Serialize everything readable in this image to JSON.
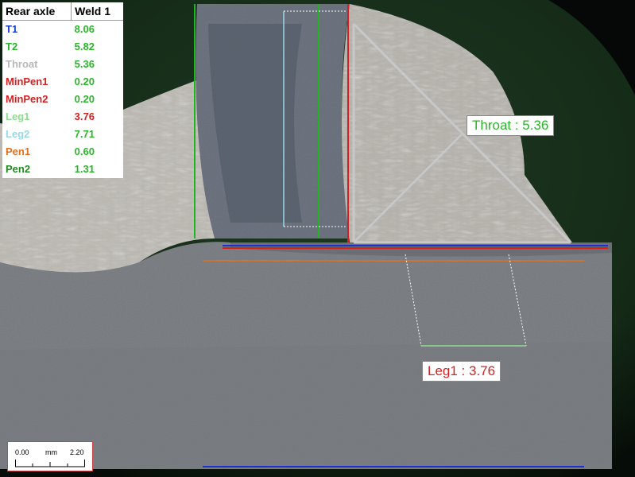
{
  "table": {
    "header_left": "Rear axle",
    "header_right": "Weld 1",
    "rows": [
      {
        "label": "T1",
        "value": "8.06",
        "label_color": "#1a3fd0",
        "value_color": "#2ab52a"
      },
      {
        "label": "T2",
        "value": "5.82",
        "label_color": "#2ab52a",
        "value_color": "#2ab52a"
      },
      {
        "label": "Throat",
        "value": "5.36",
        "label_color": "#b8b8b8",
        "value_color": "#2ab52a"
      },
      {
        "label": "MinPen1",
        "value": "0.20",
        "label_color": "#d42020",
        "value_color": "#2ab52a"
      },
      {
        "label": "MinPen2",
        "value": "0.20",
        "label_color": "#d42020",
        "value_color": "#2ab52a"
      },
      {
        "label": "Leg1",
        "value": "3.76",
        "label_color": "#8fdc8f",
        "value_color": "#d42020"
      },
      {
        "label": "Leg2",
        "value": "7.71",
        "label_color": "#9ad8e6",
        "value_color": "#2ab52a"
      },
      {
        "label": "Pen1",
        "value": "0.60",
        "label_color": "#e07020",
        "value_color": "#2ab52a"
      },
      {
        "label": "Pen2",
        "value": "1.31",
        "label_color": "#208a20",
        "value_color": "#2ab52a"
      }
    ]
  },
  "callouts": {
    "throat": {
      "text": "Throat :  5.36",
      "color": "#2ab52a"
    },
    "leg1": {
      "text": "Leg1 :  3.76",
      "color": "#d42020"
    }
  },
  "scale": {
    "min": "0.00",
    "unit": "mm",
    "max": "2.20"
  }
}
